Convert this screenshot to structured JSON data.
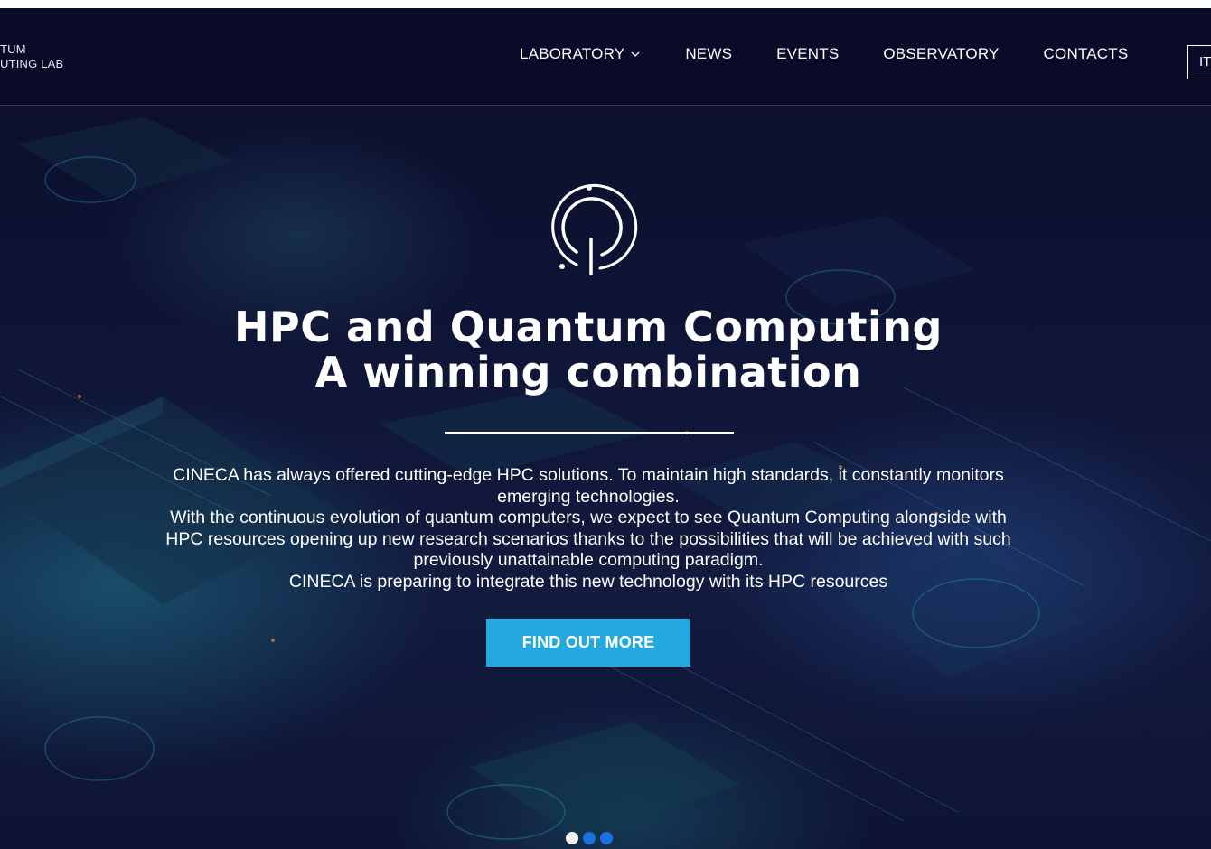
{
  "header": {
    "brand_line1": "TUM",
    "brand_line2": "UTING LAB",
    "nav": [
      {
        "label": "LABORATORY",
        "has_dropdown": true
      },
      {
        "label": "NEWS"
      },
      {
        "label": "EVENTS"
      },
      {
        "label": "OBSERVATORY"
      },
      {
        "label": "CONTACTS"
      }
    ],
    "language_button": "IT"
  },
  "hero": {
    "logo_icon": "quantum-q-logo-icon",
    "title_line1": "HPC and Quantum Computing",
    "title_line2": "A winning combination",
    "paragraph_lines": [
      "CINECA has always offered cutting-edge HPC solutions. To maintain high standards, it constantly monitors",
      "emerging technologies.",
      "With the continuous evolution of quantum computers, we expect to see Quantum Computing alongside with",
      "HPC resources opening up new research scenarios thanks to the possibilities that will be achieved with such",
      "previously unattainable computing paradigm.",
      "CINECA is preparing to integrate this new technology with its HPC resources"
    ],
    "cta_label": "FIND OUT MORE"
  },
  "carousel": {
    "dots": 3,
    "active_index": 0
  },
  "colors": {
    "header_bg": "#0a0b28",
    "cta_bg": "#25a8e0",
    "dot_active": "#f2f2f2",
    "dot_inactive": "#1e6fe0"
  }
}
